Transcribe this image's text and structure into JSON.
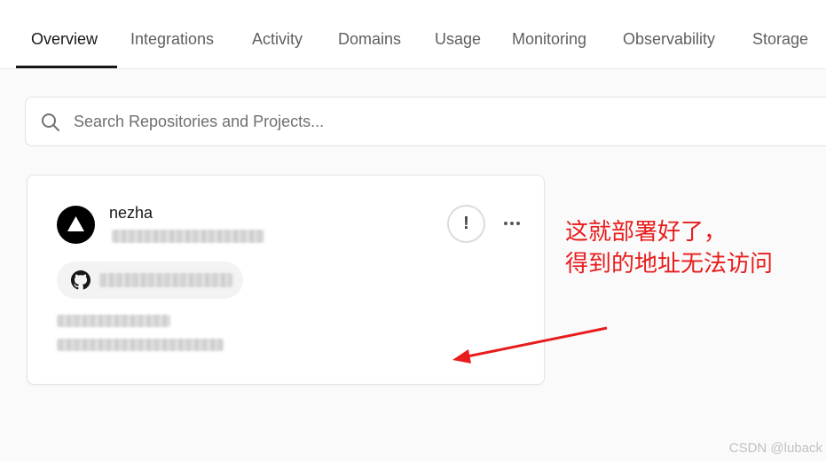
{
  "tabs": [
    {
      "label": "Overview",
      "active": true
    },
    {
      "label": "Integrations",
      "active": false
    },
    {
      "label": "Activity",
      "active": false
    },
    {
      "label": "Domains",
      "active": false
    },
    {
      "label": "Usage",
      "active": false
    },
    {
      "label": "Monitoring",
      "active": false
    },
    {
      "label": "Observability",
      "active": false
    },
    {
      "label": "Storage",
      "active": false
    }
  ],
  "search": {
    "placeholder": "Search Repositories and Projects...",
    "icon": "search-icon"
  },
  "project_card": {
    "name": "nezha",
    "avatar_icon": "vercel-triangle-icon",
    "alert_icon": "exclamation-icon",
    "alert_glyph": "!",
    "more_icon": "more-horizontal-icon",
    "repo_icon": "github-icon"
  },
  "annotation": {
    "line1": "这就部署好了，",
    "line2": "得到的地址无法访问",
    "color": "#e81c1c"
  },
  "watermark": "CSDN @luback",
  "colors": {
    "active_tab": "#171717",
    "inactive_tab": "#5f5f5f",
    "annotation": "#e81c1c"
  }
}
